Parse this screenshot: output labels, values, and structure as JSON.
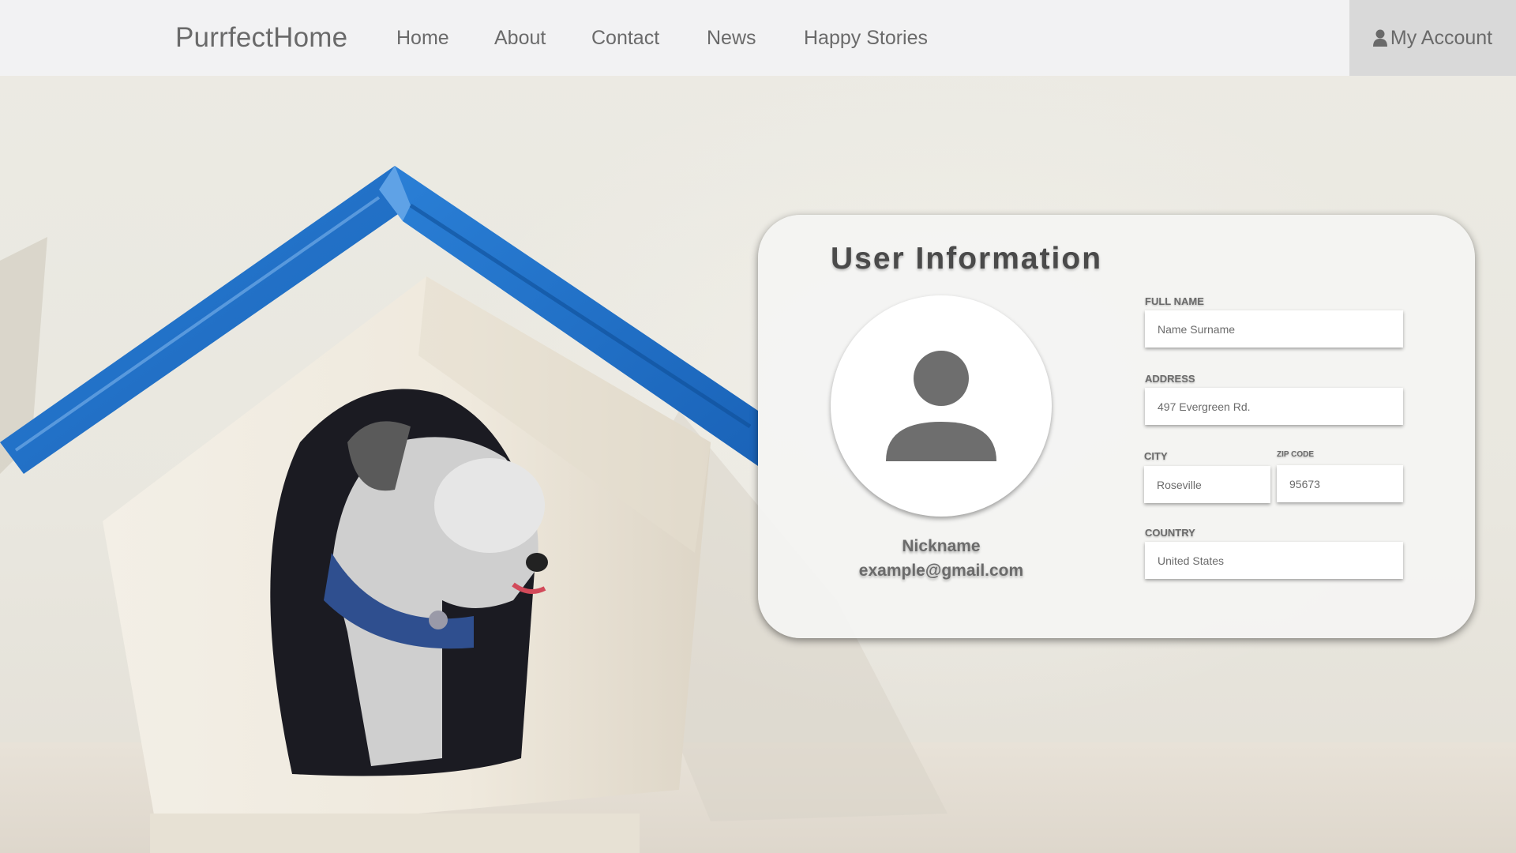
{
  "nav": {
    "brand": "PurrfectHome",
    "links": [
      "Home",
      "About",
      "Contact",
      "News",
      "Happy Stories"
    ],
    "account_label": "My Account"
  },
  "card": {
    "title": "User Information",
    "nickname": "Nickname",
    "email": "example@gmail.com",
    "fields": {
      "full_name": {
        "label": "FULL NAME",
        "placeholder": "Name Surname"
      },
      "address": {
        "label": "ADDRESS",
        "placeholder": "497 Evergreen Rd."
      },
      "city": {
        "label": "CITY",
        "placeholder": "Roseville"
      },
      "zip": {
        "label": "ZIP CODE",
        "placeholder": "95673"
      },
      "country": {
        "label": "COUNTRY",
        "placeholder": "United States"
      }
    }
  },
  "colors": {
    "nav_bg": "#f2f2f3",
    "account_bg": "#d9d9d9",
    "text": "#6a6a6a",
    "roof_blue": "#1f6fc5"
  },
  "icons": {
    "account": "user-icon",
    "avatar": "user-silhouette-icon"
  }
}
